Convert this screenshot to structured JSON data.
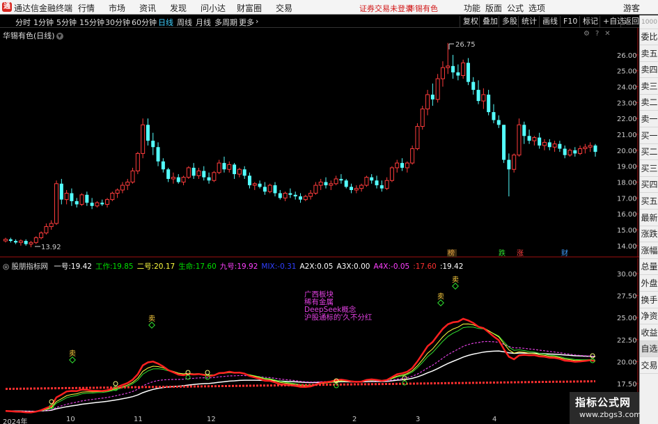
{
  "menubar": {
    "app_name": "通达信金融终端",
    "items": [
      "行情",
      "市场",
      "资讯",
      "发现",
      "问小达",
      "财富圈",
      "交易"
    ],
    "login_warning": "证券交易未登录",
    "stock_name": "华锡有色",
    "right_items": [
      "功能",
      "版面",
      "公式",
      "选项"
    ],
    "guest": "游客"
  },
  "periods": [
    "分时",
    "1分钟",
    "5分钟",
    "15分钟",
    "30分钟",
    "60分钟",
    "日线",
    "周线",
    "月线",
    "多周期",
    "更多"
  ],
  "active_period": "日线",
  "toolbar_buttons": [
    "复权",
    "叠加",
    "多股",
    "统计",
    "画线",
    "F10",
    "标记",
    "+自选",
    "返回"
  ],
  "stock_title": "华锡有色(日线)",
  "sidebar": [
    "委比",
    "卖五",
    "卖四",
    "卖三",
    "卖二",
    "卖一",
    "买一",
    "买二",
    "买三",
    "买四",
    "买五",
    "最新",
    "涨跌",
    "涨幅",
    "总量",
    "外盘",
    "换手",
    "净资",
    "收益",
    "自选",
    "交易"
  ],
  "sidebar_top": "1000",
  "main_axis": [
    "26.00",
    "25.00",
    "24.00",
    "23.00",
    "22.00",
    "21.00",
    "20.00",
    "19.00",
    "18.00",
    "17.00",
    "16.00",
    "15.00",
    "14.00"
  ],
  "main_annotations": {
    "high": "26.75",
    "low": "13.92",
    "event_labels": [
      "榜",
      "跌",
      "涨",
      "财"
    ]
  },
  "indicator": {
    "name": "股朋指标网",
    "values": [
      {
        "label": "一号:",
        "value": "19.42",
        "color": "#ffffff"
      },
      {
        "label": "工作:",
        "value": "19.85",
        "color": "#00e000"
      },
      {
        "label": "二号:",
        "value": "20.17",
        "color": "#ffff40"
      },
      {
        "label": "生命:",
        "value": "17.60",
        "color": "#00e000"
      },
      {
        "label": "九号:",
        "value": "19.92",
        "color": "#ff40ff"
      },
      {
        "label": "MIX:",
        "value": "-0.31",
        "color": "#3040ff"
      },
      {
        "label": "A2X:",
        "value": "0.05",
        "color": "#ffffff"
      },
      {
        "label": "A3X:",
        "value": "0.00",
        "color": "#ffffff"
      },
      {
        "label": "A4X:",
        "value": "-0.05",
        "color": "#ff40ff"
      },
      {
        "label": ":",
        "value": "17.60",
        "color": "#ff3030"
      },
      {
        "label": ":",
        "value": "19.42",
        "color": "#ffffff"
      }
    ],
    "notes": [
      "广西板块",
      "稀有金属",
      "DeepSeek概念",
      "沪股通标的'久不分红"
    ],
    "axis": [
      "30.00",
      "27.50",
      "25.00",
      "22.50",
      "20.00",
      "17.50"
    ],
    "sell_label": "卖"
  },
  "date_axis": [
    "2024年",
    "10",
    "11",
    "12",
    "2",
    "3",
    "4"
  ],
  "watermark": {
    "line1": "指标公式网",
    "line2": "www.zbgs3.com"
  },
  "colors": {
    "up": "#ff3c3c",
    "down": "#54ffff",
    "line_ma": "#ffffff"
  },
  "chart_data": {
    "type": "candlestick",
    "title": "华锡有色(日线)",
    "ylim": [
      13.6,
      27.0
    ],
    "candles": [
      [
        14.3,
        14.5,
        14.2,
        14.4
      ],
      [
        14.4,
        14.5,
        14.2,
        14.3
      ],
      [
        14.3,
        14.4,
        14.1,
        14.2
      ],
      [
        14.2,
        14.4,
        14.0,
        14.3
      ],
      [
        14.3,
        14.4,
        14.0,
        14.1
      ],
      [
        14.1,
        14.3,
        13.9,
        14.2
      ],
      [
        14.2,
        14.6,
        14.1,
        14.5
      ],
      [
        14.5,
        14.9,
        14.4,
        14.8
      ],
      [
        14.8,
        15.4,
        14.7,
        15.2
      ],
      [
        15.2,
        15.6,
        15.0,
        15.4
      ],
      [
        15.4,
        18.1,
        15.3,
        17.9
      ],
      [
        17.9,
        18.2,
        16.6,
        16.9
      ],
      [
        16.9,
        17.5,
        16.6,
        17.3
      ],
      [
        17.3,
        17.6,
        16.5,
        16.8
      ],
      [
        16.8,
        17.0,
        16.4,
        16.6
      ],
      [
        16.6,
        17.3,
        16.5,
        17.2
      ],
      [
        17.2,
        17.4,
        16.5,
        16.7
      ],
      [
        16.7,
        17.0,
        16.3,
        16.5
      ],
      [
        16.5,
        16.8,
        16.4,
        16.7
      ],
      [
        16.7,
        16.9,
        16.5,
        16.6
      ],
      [
        16.6,
        17.0,
        16.4,
        16.9
      ],
      [
        16.9,
        17.4,
        16.8,
        17.3
      ],
      [
        17.3,
        17.6,
        17.0,
        17.5
      ],
      [
        17.5,
        18.0,
        17.3,
        17.8
      ],
      [
        17.8,
        18.2,
        17.5,
        18.0
      ],
      [
        18.0,
        18.9,
        17.9,
        18.7
      ],
      [
        18.7,
        19.9,
        18.5,
        19.8
      ],
      [
        19.8,
        22.0,
        19.5,
        21.6
      ],
      [
        21.6,
        22.0,
        20.3,
        20.6
      ],
      [
        20.6,
        21.1,
        19.7,
        20.2
      ],
      [
        20.2,
        20.5,
        19.0,
        19.3
      ],
      [
        19.3,
        19.5,
        18.6,
        18.8
      ],
      [
        18.8,
        18.9,
        18.0,
        18.2
      ],
      [
        18.2,
        18.6,
        17.9,
        18.3
      ],
      [
        18.3,
        18.5,
        17.9,
        18.0
      ],
      [
        18.0,
        18.4,
        17.8,
        18.3
      ],
      [
        18.3,
        19.0,
        18.2,
        18.9
      ],
      [
        18.9,
        19.2,
        18.2,
        18.4
      ],
      [
        18.4,
        18.9,
        18.2,
        18.7
      ],
      [
        18.7,
        19.0,
        18.1,
        18.3
      ],
      [
        18.3,
        18.6,
        17.9,
        18.1
      ],
      [
        18.1,
        18.7,
        18.0,
        18.6
      ],
      [
        18.6,
        19.4,
        18.5,
        19.2
      ],
      [
        19.2,
        19.6,
        18.6,
        18.8
      ],
      [
        18.8,
        19.3,
        18.6,
        19.1
      ],
      [
        19.1,
        19.2,
        18.2,
        18.5
      ],
      [
        18.5,
        18.9,
        18.3,
        18.8
      ],
      [
        18.8,
        19.0,
        18.2,
        18.4
      ],
      [
        18.4,
        18.6,
        17.6,
        17.8
      ],
      [
        17.8,
        18.0,
        17.5,
        17.9
      ],
      [
        17.9,
        18.1,
        17.6,
        17.7
      ],
      [
        17.7,
        18.0,
        17.2,
        17.4
      ],
      [
        17.4,
        17.9,
        17.3,
        17.8
      ],
      [
        17.8,
        18.0,
        17.1,
        17.3
      ],
      [
        17.3,
        17.5,
        16.9,
        17.0
      ],
      [
        17.0,
        17.4,
        16.8,
        17.3
      ],
      [
        17.3,
        17.6,
        17.0,
        17.2
      ],
      [
        17.2,
        17.4,
        16.9,
        17.1
      ],
      [
        17.1,
        17.3,
        16.7,
        16.9
      ],
      [
        16.9,
        17.2,
        16.8,
        17.1
      ],
      [
        17.1,
        17.5,
        16.9,
        17.3
      ],
      [
        17.3,
        18.0,
        17.2,
        17.8
      ],
      [
        17.8,
        18.2,
        17.5,
        18.0
      ],
      [
        18.0,
        18.3,
        17.6,
        17.8
      ],
      [
        17.8,
        18.1,
        17.5,
        17.9
      ],
      [
        17.9,
        18.4,
        17.8,
        18.2
      ],
      [
        18.2,
        18.5,
        17.9,
        18.1
      ],
      [
        18.1,
        18.2,
        17.6,
        17.7
      ],
      [
        17.7,
        17.9,
        17.3,
        17.5
      ],
      [
        17.5,
        17.8,
        17.3,
        17.6
      ],
      [
        17.6,
        17.9,
        17.4,
        17.8
      ],
      [
        17.8,
        18.4,
        17.7,
        18.3
      ],
      [
        18.3,
        18.5,
        17.9,
        18.1
      ],
      [
        18.1,
        18.4,
        17.6,
        17.8
      ],
      [
        17.8,
        18.1,
        17.4,
        17.6
      ],
      [
        17.6,
        18.3,
        17.5,
        18.1
      ],
      [
        18.1,
        19.0,
        18.0,
        18.9
      ],
      [
        18.9,
        19.4,
        18.6,
        19.2
      ],
      [
        19.2,
        19.5,
        18.7,
        18.9
      ],
      [
        18.9,
        19.3,
        18.6,
        19.2
      ],
      [
        19.2,
        20.3,
        19.1,
        20.1
      ],
      [
        20.1,
        21.7,
        20.0,
        21.5
      ],
      [
        21.5,
        22.8,
        21.3,
        22.6
      ],
      [
        22.6,
        23.8,
        22.2,
        23.5
      ],
      [
        23.5,
        24.2,
        22.8,
        23.2
      ],
      [
        23.2,
        24.8,
        23.0,
        24.5
      ],
      [
        24.5,
        25.6,
        24.0,
        25.2
      ],
      [
        25.2,
        26.75,
        24.8,
        25.3
      ],
      [
        25.3,
        26.0,
        24.5,
        24.9
      ],
      [
        24.9,
        25.4,
        24.4,
        24.7
      ],
      [
        24.7,
        25.7,
        24.5,
        25.5
      ],
      [
        25.5,
        25.8,
        24.1,
        24.3
      ],
      [
        24.3,
        24.6,
        23.5,
        23.8
      ],
      [
        23.8,
        24.4,
        22.9,
        23.1
      ],
      [
        23.1,
        23.9,
        22.6,
        23.5
      ],
      [
        23.5,
        23.8,
        22.2,
        22.4
      ],
      [
        22.4,
        22.9,
        21.7,
        21.9
      ],
      [
        21.9,
        22.2,
        21.4,
        21.6
      ],
      [
        21.6,
        21.6,
        19.2,
        19.4
      ],
      [
        19.4,
        19.8,
        17.1,
        18.8
      ],
      [
        18.8,
        19.8,
        18.6,
        19.7
      ],
      [
        19.7,
        22.0,
        19.6,
        21.6
      ],
      [
        21.6,
        21.8,
        20.4,
        20.9
      ],
      [
        20.9,
        21.3,
        20.4,
        20.6
      ],
      [
        20.6,
        20.9,
        20.3,
        20.8
      ],
      [
        20.8,
        21.1,
        20.1,
        20.3
      ],
      [
        20.3,
        20.7,
        20.0,
        20.5
      ],
      [
        20.5,
        20.7,
        20.0,
        20.2
      ],
      [
        20.2,
        20.6,
        19.9,
        20.4
      ],
      [
        20.4,
        20.6,
        19.9,
        20.1
      ],
      [
        20.1,
        20.3,
        19.5,
        19.7
      ],
      [
        19.7,
        20.1,
        19.6,
        20.0
      ],
      [
        20.0,
        20.2,
        19.6,
        19.8
      ],
      [
        19.8,
        20.3,
        19.7,
        20.1
      ],
      [
        20.1,
        20.4,
        19.8,
        20.2
      ],
      [
        20.2,
        20.5,
        19.9,
        20.3
      ],
      [
        20.3,
        20.4,
        19.6,
        19.9
      ]
    ]
  }
}
